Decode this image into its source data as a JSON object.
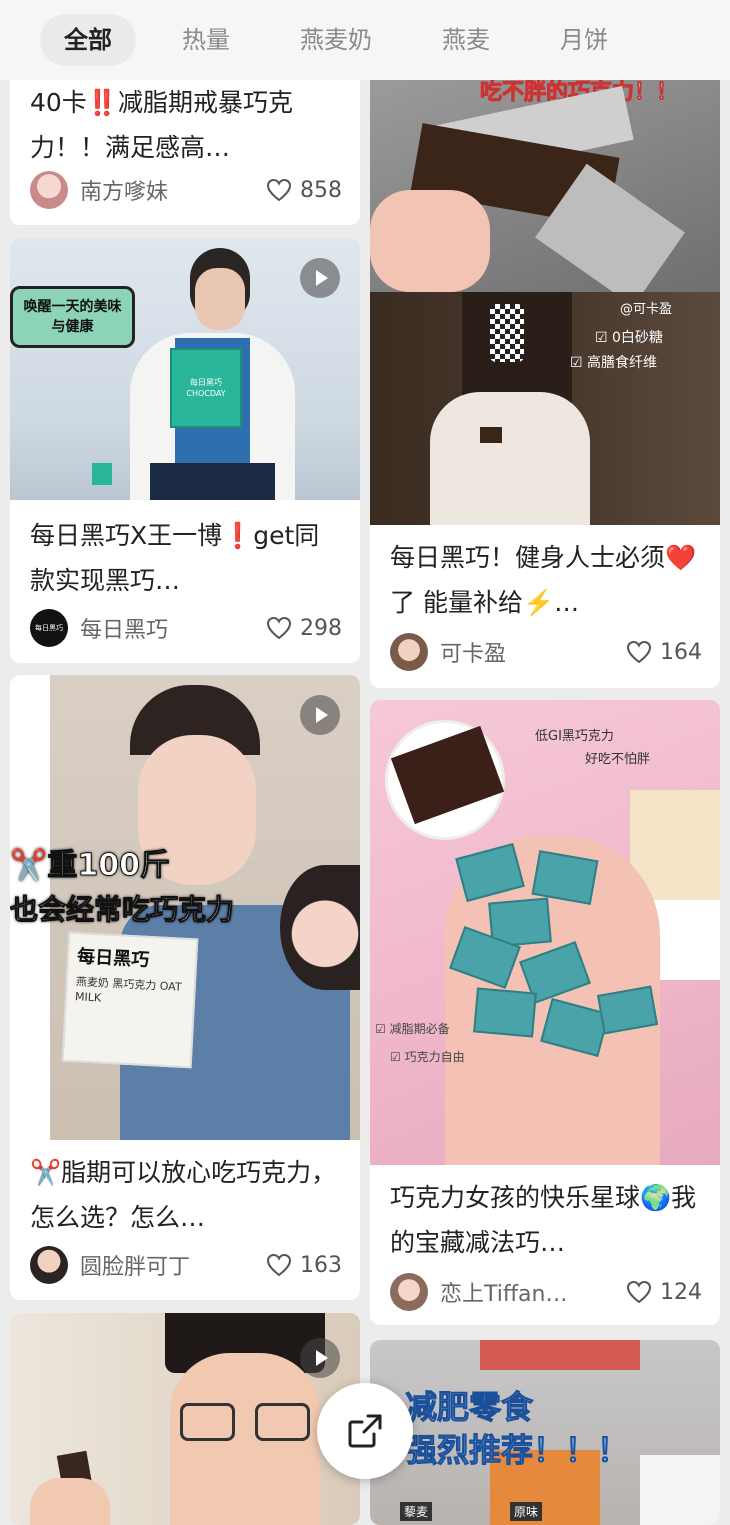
{
  "tabs": [
    {
      "label": "全部",
      "active": true
    },
    {
      "label": "热量",
      "active": false
    },
    {
      "label": "燕麦奶",
      "active": false
    },
    {
      "label": "燕麦",
      "active": false
    },
    {
      "label": "月饼",
      "active": false
    }
  ],
  "cards": {
    "c1": {
      "title": "40卡‼️减脂期戒暴巧克力！！满足感高…",
      "author": "南方嗲妹",
      "likes": "858"
    },
    "c2": {
      "overlay": "唤醒一天的美味与健康",
      "box_text": "每日黑巧 CHOCDAY",
      "title": "每日黑巧X王一博❗get同款实现黑巧…",
      "author": "每日黑巧",
      "avatar_text": "每日黑巧",
      "likes": "298"
    },
    "c3": {
      "overlay": "吃不胖的巧克力！！",
      "title": "",
      "author": "",
      "likes": ""
    },
    "c4": {
      "overlay_brand": "@可卡盈",
      "check1": "0白砂糖",
      "check2": "高膳食纤维",
      "title": "每日黑巧！健身人士必须❤️了 能量补给⚡️…",
      "author": "可卡盈",
      "likes": "164"
    },
    "c5": {
      "overlay_line1": "✂️重100斤",
      "overlay_line2": "也会经常吃巧克力",
      "pack_brand": "每日黑巧",
      "pack_text": "燕麦奶 黑巧克力 OAT MILK",
      "title": "✂️脂期可以放心吃巧克力，怎么选？怎么…",
      "author": "圆脸胖可丁",
      "likes": "163"
    },
    "c6": {
      "sticker1": "低GI黑巧克力",
      "sticker2": "好吃不怕胖",
      "note1": "减脂期必备",
      "note2": "巧克力自由",
      "title": "巧克力女孩的快乐星球🌍我的宝藏减法巧…",
      "author": "恋上Tiffan…",
      "likes": "124"
    },
    "c7": {
      "title": ""
    },
    "c8": {
      "overlay_line1": "减肥零食",
      "overlay_line2": "强烈推荐！！！",
      "label1": "藜麦",
      "label2": "原味"
    }
  },
  "fab": {
    "icon": "share-icon"
  },
  "colors": {
    "accent": "#e8323c",
    "tab_active_bg": "#eaeaea",
    "page_bg": "#ececec"
  }
}
